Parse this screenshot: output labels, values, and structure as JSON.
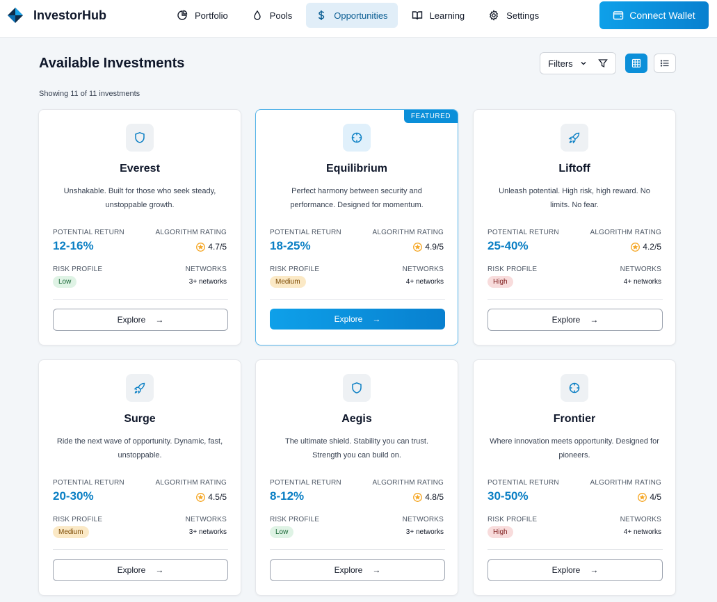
{
  "app": {
    "name": "InvestorHub"
  },
  "nav": [
    {
      "label": "Portfolio",
      "icon": "pie-chart-icon",
      "active": false
    },
    {
      "label": "Pools",
      "icon": "droplet-icon",
      "active": false
    },
    {
      "label": "Opportunities",
      "icon": "dollar-icon",
      "active": true
    },
    {
      "label": "Learning",
      "icon": "book-icon",
      "active": false
    },
    {
      "label": "Settings",
      "icon": "gear-icon",
      "active": false
    }
  ],
  "header": {
    "connect_label": "Connect Wallet",
    "connect_icon": "wallet-icon"
  },
  "page": {
    "title": "Available Investments",
    "filters_label": "Filters",
    "showing": "Showing 11 of 11 investments"
  },
  "labels": {
    "potential_return": "POTENTIAL RETURN",
    "algorithm_rating": "ALGORITHM RATING",
    "risk_profile": "RISK PROFILE",
    "networks": "NETWORKS",
    "featured": "FEATURED",
    "explore": "Explore"
  },
  "colors": {
    "accent": "#0b8fd9",
    "return_text": "#0b7fc4"
  },
  "cards": [
    {
      "name": "Everest",
      "icon": "shield-icon",
      "desc": "Unshakable. Built for those who seek steady, unstoppable growth.",
      "return": "12-16%",
      "rating": "4.7/5",
      "risk": "Low",
      "networks": "3+ networks",
      "featured": false
    },
    {
      "name": "Equilibrium",
      "icon": "crosshair-icon",
      "desc": "Perfect harmony between security and performance. Designed for momentum.",
      "return": "18-25%",
      "rating": "4.9/5",
      "risk": "Medium",
      "networks": "4+ networks",
      "featured": true
    },
    {
      "name": "Liftoff",
      "icon": "rocket-icon",
      "desc": "Unleash potential. High risk, high reward. No limits. No fear.",
      "return": "25-40%",
      "rating": "4.2/5",
      "risk": "High",
      "networks": "4+ networks",
      "featured": false
    },
    {
      "name": "Surge",
      "icon": "rocket-icon",
      "desc": "Ride the next wave of opportunity. Dynamic, fast, unstoppable.",
      "return": "20-30%",
      "rating": "4.5/5",
      "risk": "Medium",
      "networks": "3+ networks",
      "featured": false
    },
    {
      "name": "Aegis",
      "icon": "shield-icon",
      "desc": "The ultimate shield. Stability you can trust. Strength you can build on.",
      "return": "8-12%",
      "rating": "4.8/5",
      "risk": "Low",
      "networks": "3+ networks",
      "featured": false
    },
    {
      "name": "Frontier",
      "icon": "crosshair-icon",
      "desc": "Where innovation meets opportunity. Designed for pioneers.",
      "return": "30-50%",
      "rating": "4/5",
      "risk": "High",
      "networks": "4+ networks",
      "featured": false
    }
  ]
}
